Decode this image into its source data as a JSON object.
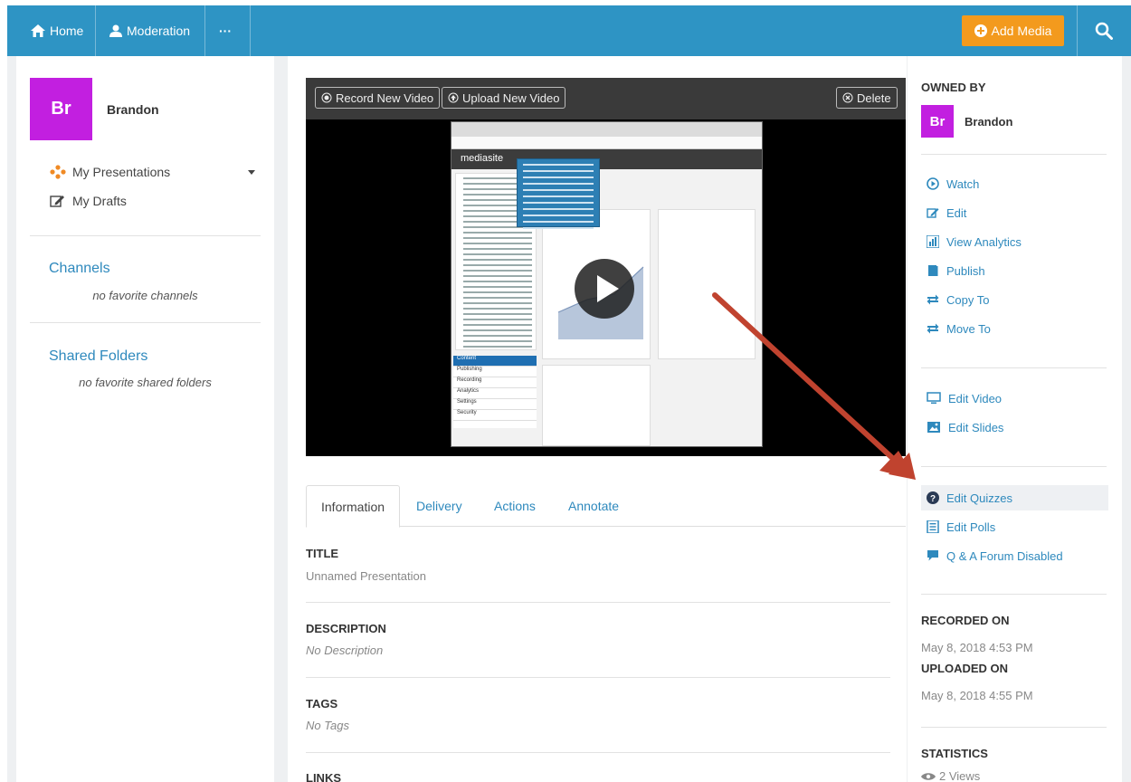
{
  "nav": {
    "home_label": "Home",
    "moderation_label": "Moderation",
    "more_label": "···",
    "add_media_label": "Add Media",
    "colors": {
      "bar": "#2e94c4",
      "add_media": "#f39a1d"
    }
  },
  "sidebar": {
    "user": {
      "initials": "Br",
      "name": "Brandon"
    },
    "items": [
      {
        "label": "My Presentations",
        "icon": "presentations-icon"
      },
      {
        "label": "My Drafts",
        "icon": "edit-icon"
      }
    ],
    "channels": {
      "title": "Channels",
      "empty": "no favorite channels"
    },
    "shared_folders": {
      "title": "Shared Folders",
      "empty": "no favorite shared folders"
    }
  },
  "video": {
    "record_label": "Record New Video",
    "upload_label": "Upload New Video",
    "delete_label": "Delete",
    "screen": {
      "brand": "mediasite",
      "nav_items": [
        "Content",
        "Publishing",
        "Recording",
        "Analytics",
        "Settings",
        "Security"
      ]
    }
  },
  "tabs": [
    {
      "label": "Information",
      "active": true
    },
    {
      "label": "Delivery",
      "active": false
    },
    {
      "label": "Actions",
      "active": false
    },
    {
      "label": "Annotate",
      "active": false
    }
  ],
  "fields": {
    "title_label": "TITLE",
    "title_value": "Unnamed Presentation",
    "description_label": "DESCRIPTION",
    "description_value": "No Description",
    "tags_label": "TAGS",
    "tags_value": "No Tags",
    "links_label": "LINKS"
  },
  "right": {
    "owned_by_label": "OWNED BY",
    "owner": {
      "initials": "Br",
      "name": "Brandon"
    },
    "actions": [
      {
        "label": "Watch",
        "icon": "play-circle-icon"
      },
      {
        "label": "Edit",
        "icon": "edit-icon"
      },
      {
        "label": "View Analytics",
        "icon": "analytics-icon"
      },
      {
        "label": "Publish",
        "icon": "book-icon"
      },
      {
        "label": "Copy To",
        "icon": "exchange-icon"
      },
      {
        "label": "Move To",
        "icon": "exchange-icon"
      }
    ],
    "media_actions": [
      {
        "label": "Edit Video",
        "icon": "monitor-icon"
      },
      {
        "label": "Edit Slides",
        "icon": "image-icon"
      }
    ],
    "interactive_actions": [
      {
        "label": "Edit Quizzes",
        "icon": "question-circle-icon"
      },
      {
        "label": "Edit Polls",
        "icon": "list-icon"
      },
      {
        "label": "Q & A Forum Disabled",
        "icon": "comment-icon"
      }
    ],
    "recorded_on_label": "RECORDED ON",
    "recorded_on_value": "May 8, 2018 4:53 PM",
    "uploaded_on_label": "UPLOADED ON",
    "uploaded_on_value": "May 8, 2018 4:55 PM",
    "statistics_label": "STATISTICS",
    "views_value": "2 Views"
  }
}
